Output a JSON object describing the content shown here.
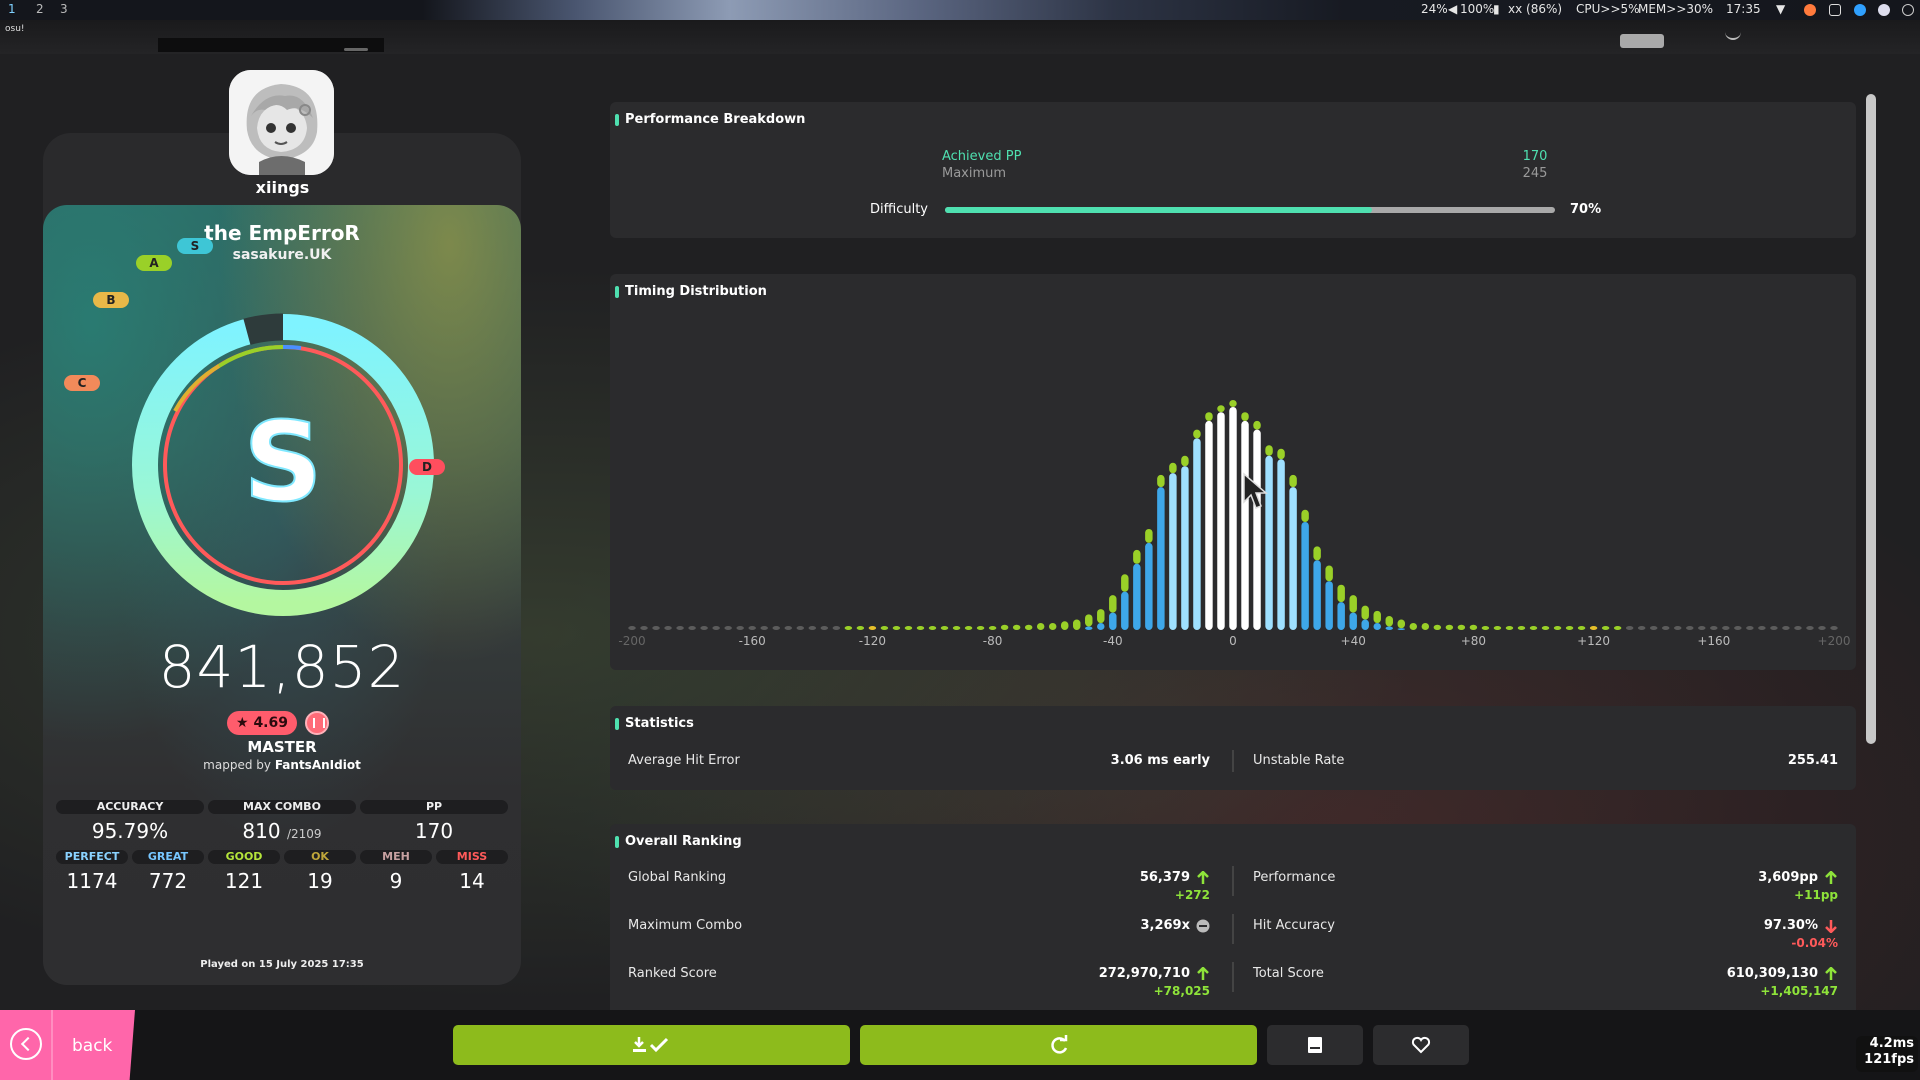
{
  "system_bar": {
    "workspaces": [
      "1",
      "2",
      "3"
    ],
    "status_items": [
      "24%",
      "100%",
      "xx (86%)",
      "CPU>>5%",
      "MEM>>30%",
      "17:35"
    ],
    "app_name": "osu!"
  },
  "player": {
    "username": "xiings"
  },
  "beatmap": {
    "title": "the EmpErroR",
    "artist": "sasakure.UK",
    "star_rating": "★ 4.69",
    "difficulty": "MASTER",
    "mapped_by_prefix": "mapped by",
    "mapper": "FantsAnIdiot"
  },
  "grade": {
    "rank": "S",
    "accuracy_fraction": 0.9579,
    "markers": [
      "S",
      "A",
      "B",
      "C",
      "D"
    ]
  },
  "score": "841,852",
  "stats": {
    "accuracy_label": "ACCURACY",
    "accuracy": "95.79%",
    "max_combo_label": "MAX COMBO",
    "max_combo": "810",
    "max_combo_total": "/2109",
    "pp_label": "PP",
    "pp": "170"
  },
  "judgements": [
    {
      "label": "PERFECT",
      "count": "1174",
      "color": "#8ad2ff"
    },
    {
      "label": "GREAT",
      "count": "772",
      "color": "#77c6ff"
    },
    {
      "label": "GOOD",
      "count": "121",
      "color": "#b5e53b"
    },
    {
      "label": "OK",
      "count": "19",
      "color": "#bfa63a"
    },
    {
      "label": "MEH",
      "count": "9",
      "color": "#c6a0a0"
    },
    {
      "label": "MISS",
      "count": "14",
      "color": "#ff5a5a"
    }
  ],
  "played_on": "Played on 15 July 2025 17:35",
  "performance": {
    "title": "Performance Breakdown",
    "achieved_label": "Achieved PP",
    "achieved_value": "170",
    "maximum_label": "Maximum",
    "maximum_value": "245",
    "difficulty_label": "Difficulty",
    "difficulty_percent": "70%",
    "difficulty_fraction": 0.7
  },
  "timing": {
    "title": "Timing Distribution",
    "x_ticks": [
      "-200",
      "-160",
      "-120",
      "-80",
      "-40",
      "0",
      "+40",
      "+80",
      "+120",
      "+160",
      "+200"
    ]
  },
  "chart_data": {
    "type": "bar",
    "xlabel": "",
    "ylabel": "",
    "xlim": [
      -200,
      200
    ],
    "bin_width_ms": 4,
    "x": [
      -200,
      -196,
      -192,
      -188,
      -184,
      -180,
      -176,
      -172,
      -168,
      -164,
      -160,
      -156,
      -152,
      -148,
      -144,
      -140,
      -136,
      -132,
      -128,
      -124,
      -120,
      -116,
      -112,
      -108,
      -104,
      -100,
      -96,
      -92,
      -88,
      -84,
      -80,
      -76,
      -72,
      -68,
      -64,
      -60,
      -56,
      -52,
      -48,
      -44,
      -40,
      -36,
      -32,
      -28,
      -24,
      -20,
      -16,
      -12,
      -8,
      -4,
      0,
      4,
      8,
      12,
      16,
      20,
      24,
      28,
      32,
      36,
      40,
      44,
      48,
      52,
      56,
      60,
      64,
      68,
      72,
      76,
      80,
      84,
      88,
      92,
      96,
      100,
      104,
      108,
      112,
      116,
      120,
      124,
      128,
      132,
      136,
      140,
      144,
      148,
      152,
      156,
      160,
      164,
      168,
      172,
      176,
      180,
      184,
      188,
      192,
      196,
      200
    ],
    "series": [
      {
        "values": [
          0,
          0,
          0,
          0,
          0,
          0,
          0,
          0,
          0,
          0,
          0,
          0,
          0,
          0,
          0,
          0,
          0,
          0,
          0,
          0,
          0,
          0,
          0,
          0,
          0,
          0,
          0,
          0,
          0,
          0,
          0,
          0,
          0,
          0,
          0,
          0,
          0,
          0,
          2,
          4,
          10,
          22,
          38,
          50,
          82,
          90,
          94,
          110,
          120,
          125,
          128,
          120,
          115,
          100,
          98,
          82,
          62,
          40,
          28,
          16,
          10,
          6,
          4,
          2,
          1,
          0,
          0,
          0,
          0,
          0,
          0,
          0,
          0,
          0,
          0,
          0,
          0,
          0,
          0,
          0,
          0,
          0,
          0,
          0,
          0,
          0,
          0,
          0,
          0,
          0,
          0,
          0,
          0,
          0,
          0,
          0,
          0,
          0,
          0,
          0,
          0
        ]
      },
      {
        "values": [
          1,
          1,
          1,
          1,
          1,
          1,
          1,
          1,
          1,
          1,
          1,
          1,
          1,
          1,
          1,
          1,
          1,
          1,
          1,
          1,
          1,
          1,
          1,
          1,
          1,
          1,
          1,
          1,
          1,
          2,
          2,
          3,
          3,
          3,
          4,
          4,
          5,
          6,
          7,
          8,
          10,
          10,
          8,
          8,
          7,
          6,
          6,
          5,
          5,
          4,
          4,
          5,
          5,
          6,
          6,
          7,
          7,
          8,
          9,
          10,
          10,
          8,
          7,
          6,
          5,
          4,
          4,
          3,
          3,
          3,
          3,
          2,
          2,
          2,
          2,
          2,
          2,
          2,
          2,
          2,
          2,
          2,
          2,
          2,
          1,
          1,
          1,
          1,
          1,
          1,
          1,
          1,
          1,
          1,
          1,
          1,
          1,
          1,
          1,
          1,
          1
        ]
      }
    ]
  },
  "statistics": {
    "title": "Statistics",
    "avg_hit_error_label": "Average Hit Error",
    "avg_hit_error": "3.06 ms early",
    "unstable_rate_label": "Unstable Rate",
    "unstable_rate": "255.41"
  },
  "ranking": {
    "title": "Overall Ranking",
    "rows": [
      {
        "label": "Global Ranking",
        "value": "56,379",
        "delta": "+272",
        "trend": "up"
      },
      {
        "label": "Performance",
        "value": "3,609pp",
        "delta": "+11pp",
        "trend": "up"
      },
      {
        "label": "Maximum Combo",
        "value": "3,269x",
        "delta": "",
        "trend": "none"
      },
      {
        "label": "Hit Accuracy",
        "value": "97.30%",
        "delta": "-0.04%",
        "trend": "down"
      },
      {
        "label": "Ranked Score",
        "value": "272,970,710",
        "delta": "+78,025",
        "trend": "up"
      },
      {
        "label": "Total Score",
        "value": "610,309,130",
        "delta": "+1,405,147",
        "trend": "up"
      }
    ]
  },
  "footer": {
    "back_label": "back",
    "buttons": [
      "download-icon",
      "retry-icon",
      "notes-icon",
      "heart-icon"
    ]
  },
  "perf_counter": {
    "frame_time": "4.2ms",
    "fps": "121fps"
  },
  "colors": {
    "accent": "#4fe0b0",
    "green_button": "#8dbb1c",
    "back_pink": "#ff66aa",
    "trend_up": "#8ee33a",
    "trend_down": "#ff5a5a",
    "hist_blue": "#3ea7e9",
    "hist_lightblue": "#9fe0ff",
    "hist_green": "#9ad028"
  }
}
